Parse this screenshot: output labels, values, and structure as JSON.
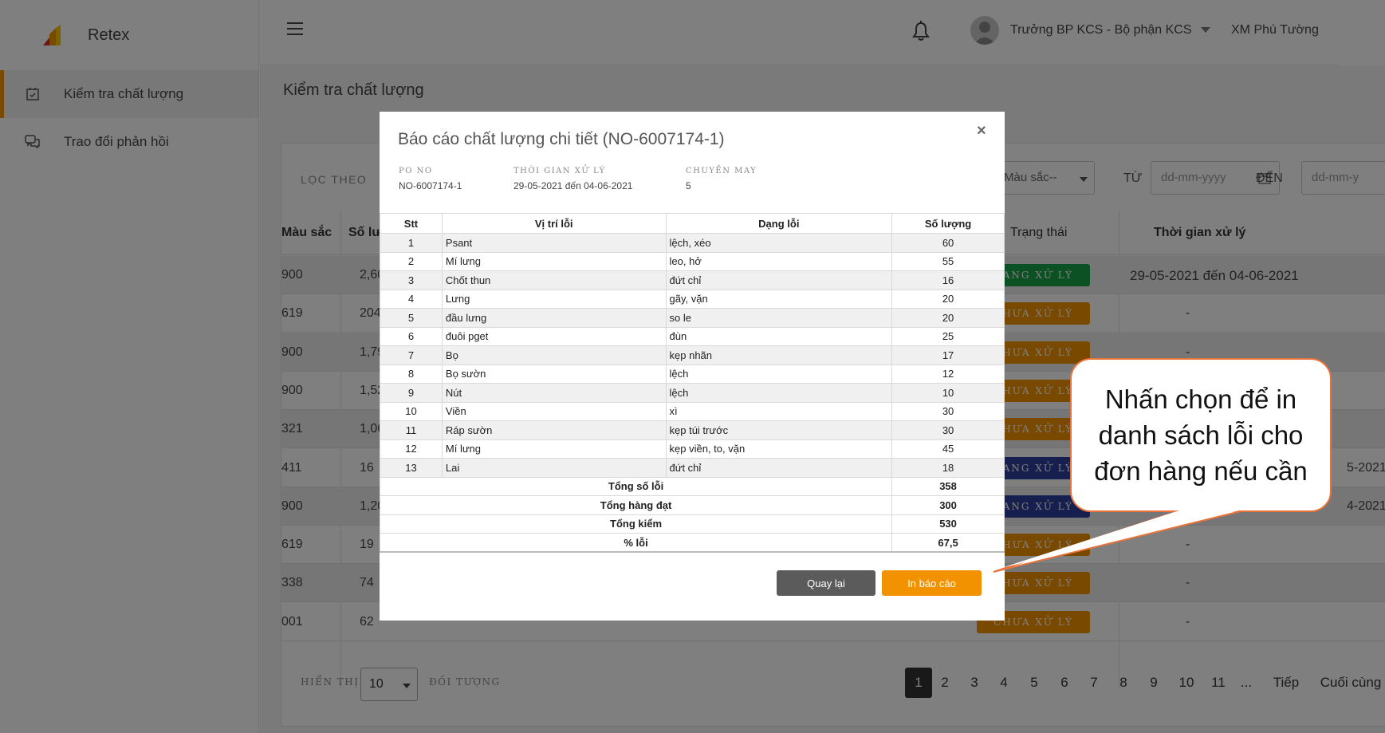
{
  "app": {
    "name": "Retex"
  },
  "sidebar": {
    "items": [
      {
        "label": "Kiểm tra chất lượng",
        "active": true
      },
      {
        "label": "Trao đổi phản hồi",
        "active": false
      }
    ]
  },
  "header": {
    "user": "Trưởng BP KCS - Bộ phận KCS",
    "company": "XM Phú Tường"
  },
  "page": {
    "title": "Kiểm tra chất lượng"
  },
  "filters": {
    "label": "LỌC THEO",
    "color_select": "-Màu sắc--",
    "from_label": "TỪ",
    "to_label": "ĐẾN",
    "date_placeholder": "dd-mm-yyyy",
    "date_placeholder_cut": "dd-mm-y"
  },
  "grid": {
    "headers": {
      "color": "Màu sắc",
      "qty": "Số lư",
      "status": "Trạng thái",
      "time": "Thời gian xử lý"
    },
    "rows": [
      {
        "color": "900",
        "qty": "2,60",
        "status": "ĐANG XỬ LÝ",
        "status_color": "#17a346",
        "time": "29-05-2021 đến 04-06-2021"
      },
      {
        "color": "619",
        "qty": "204",
        "status": "CHƯA XỬ LÝ",
        "status_color": "#f39200",
        "time": "-"
      },
      {
        "color": "900",
        "qty": "1,79",
        "status": "CHƯA XỬ LÝ",
        "status_color": "#f39200",
        "time": "-"
      },
      {
        "color": "900",
        "qty": "1,52",
        "status": "CHƯA XỬ LÝ",
        "status_color": "#f39200",
        "time": ""
      },
      {
        "color": "321",
        "qty": "1,06",
        "status": "CHƯA XỬ LÝ",
        "status_color": "#f39200",
        "time": ""
      },
      {
        "color": "411",
        "qty": "16",
        "status": "ĐANG XỬ LÝ",
        "status_color": "#2f3e9e",
        "time": "5-2021"
      },
      {
        "color": "900",
        "qty": "1,20",
        "status": "ĐANG XỬ LÝ",
        "status_color": "#2f3e9e",
        "time": "4-2021"
      },
      {
        "color": "619",
        "qty": "19",
        "status": "CHƯA XỬ LÝ",
        "status_color": "#f39200",
        "time": "-"
      },
      {
        "color": "338",
        "qty": "74",
        "status": "CHƯA XỬ LÝ",
        "status_color": "#f39200",
        "time": "-"
      },
      {
        "color": "001",
        "qty": "62",
        "status": "CHƯA XỬ LÝ",
        "status_color": "#f39200",
        "time": "-"
      }
    ]
  },
  "footer": {
    "show_label": "HIỂN THỊ",
    "page_size": "10",
    "objects_label": "ĐỐI TƯỢNG",
    "pages": [
      "1",
      "2",
      "3",
      "4",
      "5",
      "6",
      "7",
      "8",
      "9",
      "10",
      "11",
      "..."
    ],
    "current_page": "1",
    "next_label": "Tiếp",
    "last_label": "Cuối cùng"
  },
  "modal": {
    "title": "Báo cáo chất lượng chi tiết (NO-6007174-1)",
    "close_glyph": "×",
    "meta": {
      "po_label": "PO NO",
      "po_value": "NO-6007174-1",
      "time_label": "THỜI GIAN XỬ LÝ",
      "time_value": "29-05-2021 đến 04-06-2021",
      "line_label": "CHUYỀN MAY",
      "line_value": "5"
    },
    "table": {
      "headers": [
        "Stt",
        "Vị trí lỗi",
        "Dạng lỗi",
        "Số lượng"
      ],
      "rows": [
        [
          "1",
          "Psant",
          "lệch, xéo",
          "60"
        ],
        [
          "2",
          "Mí lưng",
          "leo, hở",
          "55"
        ],
        [
          "3",
          "Chốt thun",
          "đứt chỉ",
          "16"
        ],
        [
          "4",
          "Lưng",
          "gãy, vặn",
          "20"
        ],
        [
          "5",
          "đầu lưng",
          "so le",
          "20"
        ],
        [
          "6",
          "đuôi pget",
          "đùn",
          "25"
        ],
        [
          "7",
          "Bọ",
          "kẹp nhãn",
          "17"
        ],
        [
          "8",
          "Bọ sườn",
          "lệch",
          "12"
        ],
        [
          "9",
          "Nút",
          "lệch",
          "10"
        ],
        [
          "10",
          "Viền",
          "xì",
          "30"
        ],
        [
          "11",
          "Ráp sườn",
          "kẹp túi trước",
          "30"
        ],
        [
          "12",
          "Mí lưng",
          "kẹp viền, to, vặn",
          "45"
        ],
        [
          "13",
          "Lai",
          "đứt chỉ",
          "18"
        ]
      ],
      "summary": [
        [
          "Tổng số lỗi",
          "358"
        ],
        [
          "Tổng hàng đạt",
          "300"
        ],
        [
          "Tổng kiểm",
          "530"
        ],
        [
          "% lỗi",
          "67,5"
        ]
      ]
    },
    "buttons": {
      "back": "Quay lại",
      "print": "In báo cáo"
    }
  },
  "callout": {
    "text": "Nhấn chọn để in danh sách lỗi cho đơn hàng nếu cần"
  },
  "colors": {
    "accent": "#f39200",
    "status_green": "#17a346",
    "status_blue": "#2f3e9e",
    "callout_border": "#e9733b"
  }
}
